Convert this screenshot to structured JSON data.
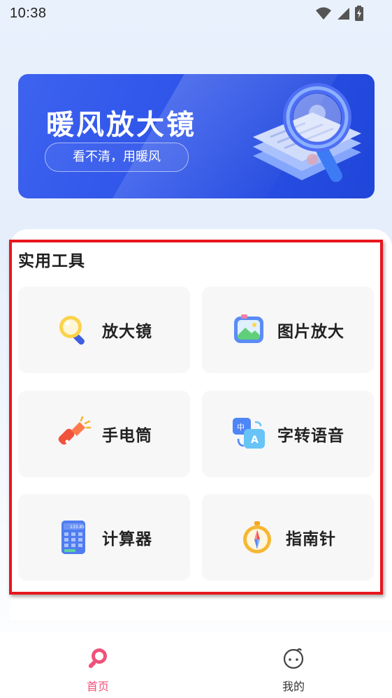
{
  "status_bar": {
    "time": "10:38",
    "icons": [
      "wifi-icon",
      "signal-icon",
      "battery-charging-icon"
    ]
  },
  "banner": {
    "title": "暖风放大镜",
    "slogan": "看不清，用暖风",
    "art": "magnifier-illustration"
  },
  "tools": {
    "section_title": "实用工具",
    "items": [
      {
        "label": "放大镜",
        "icon": "magnifier-icon"
      },
      {
        "label": "图片放大",
        "icon": "image-icon"
      },
      {
        "label": "手电筒",
        "icon": "flashlight-icon"
      },
      {
        "label": "字转语音",
        "icon": "text-to-speech-icon"
      },
      {
        "label": "计算器",
        "icon": "calculator-icon"
      },
      {
        "label": "指南针",
        "icon": "compass-icon"
      }
    ],
    "calculator_display": "133.45"
  },
  "bottom_nav": {
    "items": [
      {
        "label": "首页",
        "icon": "home-magnifier-icon",
        "active": true
      },
      {
        "label": "我的",
        "icon": "profile-face-icon",
        "active": false
      }
    ],
    "active_color": "#f0517a",
    "inactive_color": "#333333"
  },
  "colors": {
    "banner_blue": "#2f55ea",
    "highlight_red": "#e8161c",
    "tile_bg": "#f7f7f8"
  }
}
